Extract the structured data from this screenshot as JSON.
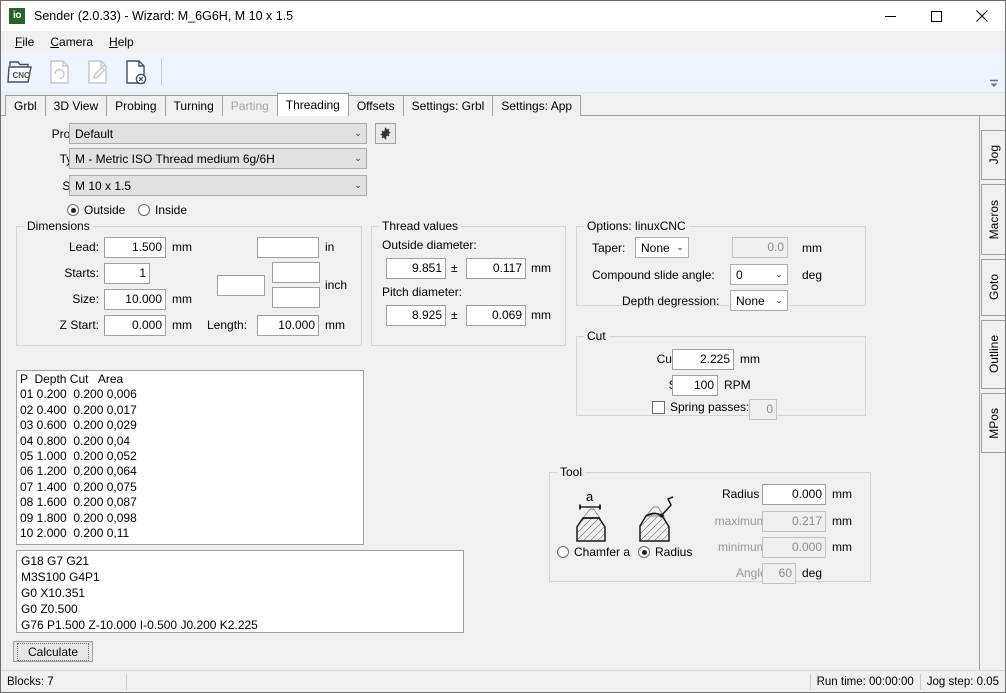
{
  "window": {
    "title": "Sender (2.0.33) - Wizard: M_6G6H, M 10 x 1.5",
    "app_icon_text": "io",
    "minimize_label": "Minimize",
    "maximize_label": "Maximize",
    "close_label": "Close"
  },
  "menubar": [
    {
      "label": "File",
      "accel": "F"
    },
    {
      "label": "Camera",
      "accel": "C"
    },
    {
      "label": "Help",
      "accel": "H"
    }
  ],
  "toolbar": {
    "buttons": [
      {
        "name": "open-cnc-file-icon",
        "label": "CNC",
        "enabled": true
      },
      {
        "name": "reload-file-icon",
        "label": "",
        "enabled": false
      },
      {
        "name": "edit-file-icon",
        "label": "",
        "enabled": false
      },
      {
        "name": "close-file-icon",
        "label": "",
        "enabled": true
      }
    ],
    "overflow_label": "More"
  },
  "tabs": [
    {
      "label": "Grbl",
      "state": "normal"
    },
    {
      "label": "3D View",
      "state": "normal"
    },
    {
      "label": "Probing",
      "state": "normal"
    },
    {
      "label": "Turning",
      "state": "normal"
    },
    {
      "label": "Parting",
      "state": "disabled"
    },
    {
      "label": "Threading",
      "state": "active"
    },
    {
      "label": "Offsets",
      "state": "normal"
    },
    {
      "label": "Settings: Grbl",
      "state": "normal"
    },
    {
      "label": "Settings: App",
      "state": "normal"
    }
  ],
  "vtabs": [
    {
      "label": "Jog"
    },
    {
      "label": "Macros"
    },
    {
      "label": "Goto"
    },
    {
      "label": "Outline"
    },
    {
      "label": "MPos"
    }
  ],
  "form": {
    "profile_label": "Profile:",
    "profile_value": "Default",
    "profile_settings_icon": "gear-icon",
    "type_label": "Type:",
    "type_value": "M - Metric ISO Thread medium 6g/6H",
    "size_label": "Size:",
    "size_value": "M 10 x 1.5",
    "outside_label": "Outside",
    "inside_label": "Inside",
    "side_selected": "Outside"
  },
  "dimensions": {
    "title": "Dimensions",
    "lead_label": "Lead:",
    "lead_value": "1.500",
    "lead_unit": "mm",
    "lead_in_value": "",
    "lead_in_unit": "in",
    "starts_label": "Starts:",
    "starts_value": "1",
    "tpi_value": "",
    "frac_top_value": "",
    "frac_bottom_value": "",
    "frac_unit": "inch",
    "size_label": "Size:",
    "size_value": "10.000",
    "size_unit": "mm",
    "zstart_label": "Z Start:",
    "zstart_value": "0.000",
    "zstart_unit": "mm",
    "length_label": "Length:",
    "length_value": "10.000",
    "length_unit": "mm"
  },
  "thread_values": {
    "title": "Thread values",
    "outside_diameter_label": "Outside diameter:",
    "outside_diameter_value": "9.851",
    "outside_diameter_tol": "0.117",
    "outside_diameter_unit": "mm",
    "pitch_diameter_label": "Pitch diameter:",
    "pitch_diameter_value": "8.925",
    "pitch_diameter_tol": "0.069",
    "pitch_diameter_unit": "mm",
    "plusminus": "±"
  },
  "options": {
    "title": "Options: linuxCNC",
    "taper_label": "Taper:",
    "taper_value": "None",
    "taper_amount": "0.0",
    "taper_unit": "mm",
    "compound_label": "Compound slide angle:",
    "compound_value": "0",
    "compound_unit": "deg",
    "degression_label": "Depth degression:",
    "degression_value": "None"
  },
  "cut": {
    "title": "Cut",
    "cut_depth_label": "Cut depth:",
    "cut_depth_value": "2.225",
    "cut_depth_unit": "mm",
    "spindle_label": "Spindle:",
    "spindle_value": "100",
    "spindle_unit": "RPM",
    "spring_passes_label": "Spring passes:",
    "spring_passes_checked": false,
    "spring_passes_value": "0"
  },
  "tool": {
    "title": "Tool",
    "chamfer_icon_label": "a",
    "radius_label": "Radius r:",
    "radius_value": "0.000",
    "radius_unit": "mm",
    "maximum_label": "maximum:",
    "maximum_value": "0.217",
    "maximum_unit": "mm",
    "minimum_label": "minimum:",
    "minimum_value": "0.000",
    "minimum_unit": "mm",
    "angle_label": "Angle:",
    "angle_value": "60",
    "angle_unit": "deg",
    "chamfer_radio_label": "Chamfer a",
    "radius_radio_label": "Radius",
    "selected": "Radius"
  },
  "passes_table": {
    "header": "P  Depth Cut   Area",
    "rows": [
      "01 0.200  0.200 0,006",
      "02 0.400  0.200 0,017",
      "03 0.600  0.200 0,029",
      "04 0.800  0.200 0,04",
      "05 1.000  0.200 0,052",
      "06 1.200  0.200 0,064",
      "07 1.400  0.200 0,075",
      "08 1.600  0.200 0,087",
      "09 1.800  0.200 0,098",
      "10 2.000  0.200 0,11"
    ]
  },
  "gcode": {
    "lines": [
      "G18 G7 G21",
      "M3S100 G4P1",
      "G0 X10.351",
      "G0 Z0.500",
      "G76 P1.500 Z-10.000 I-0.500 J0.200 K2.225"
    ]
  },
  "calculate_button": {
    "label": "Calculate"
  },
  "statusbar": {
    "blocks": "Blocks: 7",
    "message": "",
    "run_time": "Run time: 00:00:00",
    "jog_step": "Jog step: 0.05"
  },
  "colors": {
    "toolbar_bg": "#eef4fb",
    "panel_bg": "#f0f0f0",
    "accent_icon": "#28632c",
    "disabled_text": "#a6a6a6"
  }
}
